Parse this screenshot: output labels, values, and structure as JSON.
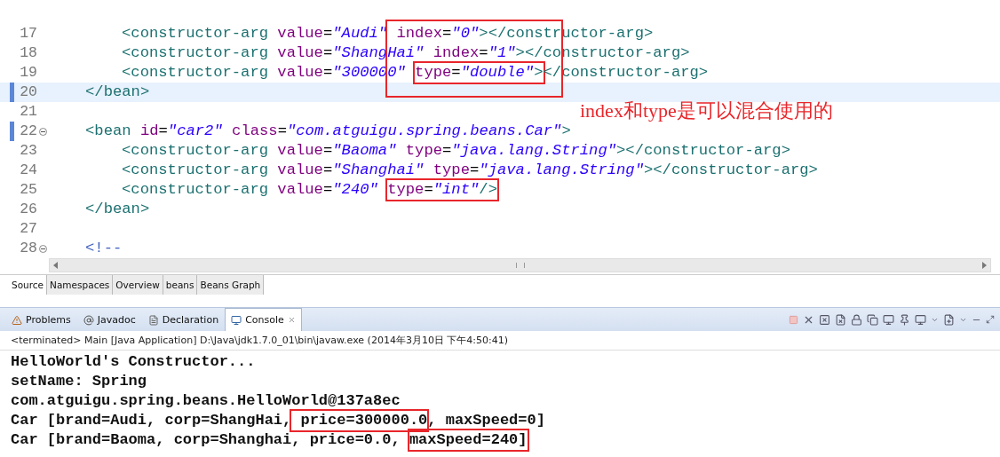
{
  "editor": {
    "lines": [
      {
        "children": [
          {
            "number": "17",
            "fold": false,
            "changed": false,
            "current": false,
            "tokens": [
              {
                "kind": "tag",
                "text": "<constructor-arg"
              },
              {
                "kind": "attr",
                "text": " value"
              },
              {
                "kind": "eq",
                "text": "="
              },
              {
                "kind": "value",
                "text": "\"Audi\""
              },
              {
                "kind": "attr",
                "text": " index"
              },
              {
                "kind": "eq",
                "text": "="
              },
              {
                "kind": "value",
                "text": "\"0\""
              },
              {
                "kind": "tag",
                "text": "></constructor-arg>"
              }
            ]
          },
          {
            "number": "18",
            "fold": false,
            "changed": false,
            "current": false,
            "tokens": [
              {
                "kind": "tag",
                "text": "<constructor-arg"
              },
              {
                "kind": "attr",
                "text": " value"
              },
              {
                "kind": "eq",
                "text": "="
              },
              {
                "kind": "value",
                "text": "\"ShangHai\""
              },
              {
                "kind": "attr",
                "text": " index"
              },
              {
                "kind": "eq",
                "text": "="
              },
              {
                "kind": "value",
                "text": "\"1\""
              },
              {
                "kind": "tag",
                "text": "></constructor-arg>"
              }
            ]
          },
          {
            "number": "19",
            "fold": false,
            "changed": false,
            "current": false,
            "tokens": [
              {
                "kind": "tag",
                "text": "<constructor-arg"
              },
              {
                "kind": "attr",
                "text": " value"
              },
              {
                "kind": "eq",
                "text": "="
              },
              {
                "kind": "value",
                "text": "\"300000\" "
              },
              {
                "kind": "group",
                "boxed": true,
                "tokens": [
                  {
                    "kind": "attr",
                    "text": "type"
                  },
                  {
                    "kind": "eq",
                    "text": "="
                  },
                  {
                    "kind": "value",
                    "text": "\"double\""
                  },
                  {
                    "kind": "tag",
                    "text": ">"
                  }
                ]
              },
              {
                "kind": "tag",
                "text": "</constructor-arg>"
              }
            ]
          }
        ]
      },
      {
        "number": "20",
        "fold": false,
        "changed": true,
        "current": true,
        "tokens": [
          {
            "kind": "tag",
            "text": "</bean>"
          }
        ]
      },
      {
        "number": "21",
        "fold": false,
        "changed": false,
        "current": false
      },
      {
        "number": "22",
        "fold": true,
        "changed": true,
        "current": false,
        "tokens": [
          {
            "kind": "tag",
            "text": "<bean"
          },
          {
            "kind": "attr",
            "text": " id"
          },
          {
            "kind": "eq",
            "text": "="
          },
          {
            "kind": "value",
            "text": "\"car2\""
          },
          {
            "kind": "attr",
            "text": " class"
          },
          {
            "kind": "eq",
            "text": "="
          },
          {
            "kind": "value",
            "text": "\"com.atguigu.spring.beans.Car\""
          },
          {
            "kind": "tag",
            "text": ">"
          }
        ],
        "children": [
          {
            "number": "23",
            "fold": false,
            "changed": false,
            "current": false,
            "tokens": [
              {
                "kind": "tag",
                "text": "<constructor-arg"
              },
              {
                "kind": "attr",
                "text": " value"
              },
              {
                "kind": "eq",
                "text": "="
              },
              {
                "kind": "value",
                "text": "\"Baoma\""
              },
              {
                "kind": "attr",
                "text": " type"
              },
              {
                "kind": "eq",
                "text": "="
              },
              {
                "kind": "value",
                "text": "\"java.lang.String\""
              },
              {
                "kind": "tag",
                "text": "></constructor-arg>"
              }
            ]
          },
          {
            "number": "24",
            "fold": false,
            "changed": false,
            "current": false,
            "tokens": [
              {
                "kind": "tag",
                "text": "<constructor-arg"
              },
              {
                "kind": "attr",
                "text": " value"
              },
              {
                "kind": "eq",
                "text": "="
              },
              {
                "kind": "value",
                "text": "\"Shanghai\""
              },
              {
                "kind": "attr",
                "text": " type"
              },
              {
                "kind": "eq",
                "text": "="
              },
              {
                "kind": "value",
                "text": "\"java.lang.String\""
              },
              {
                "kind": "tag",
                "text": "></constructor-arg>"
              }
            ]
          },
          {
            "number": "25",
            "fold": false,
            "changed": false,
            "current": false,
            "tokens": [
              {
                "kind": "tag",
                "text": "<constructor-arg"
              },
              {
                "kind": "attr",
                "text": " value"
              },
              {
                "kind": "eq",
                "text": "="
              },
              {
                "kind": "value",
                "text": "\"240\" "
              },
              {
                "kind": "group",
                "boxed": true,
                "tokens": [
                  {
                    "kind": "attr",
                    "text": "type"
                  },
                  {
                    "kind": "eq",
                    "text": "="
                  },
                  {
                    "kind": "value",
                    "text": "\"int\""
                  },
                  {
                    "kind": "tag",
                    "text": "/>"
                  }
                ]
              }
            ]
          }
        ]
      },
      {
        "number": "26",
        "fold": false,
        "changed": false,
        "current": false,
        "tokens": [
          {
            "kind": "tag",
            "text": "</bean>"
          }
        ]
      },
      {
        "number": "27",
        "fold": false,
        "changed": false,
        "current": false
      },
      {
        "number": "28",
        "fold": true,
        "changed": false,
        "current": false,
        "tokens": [
          {
            "kind": "comment",
            "text": "<!--"
          }
        ]
      }
    ],
    "note": "index和type是可以混合使用的"
  },
  "editor_bottom_tabs": [
    {
      "label": "Source",
      "selected": true
    },
    {
      "label": "Namespaces",
      "selected": false
    },
    {
      "label": "Overview",
      "selected": false
    },
    {
      "label": "beans",
      "selected": false
    },
    {
      "label": "Beans Graph",
      "selected": false
    }
  ],
  "view_tabs": [
    {
      "label": "Problems",
      "kind": "problems",
      "selected": false
    },
    {
      "label": "Javadoc",
      "kind": "javadoc",
      "selected": false
    },
    {
      "label": "Declaration",
      "kind": "declaration",
      "selected": false
    },
    {
      "label": "Console",
      "kind": "console",
      "selected": true
    }
  ],
  "console": {
    "status": "<terminated> Main [Java Application] D:\\Java\\jdk1.7.0_01\\bin\\javaw.exe (2014年3月10日 下午4:50:41)",
    "lines": [
      [
        {
          "text": "HelloWorld's Constructor..."
        }
      ],
      [
        {
          "text": "setName: Spring"
        }
      ],
      [
        {
          "text": "com.atguigu.spring.beans.HelloWorld@137a8ec"
        }
      ],
      [
        {
          "text": "Car [brand=Audi, corp=ShangHai,"
        },
        {
          "text": " price=300000.0",
          "boxed": true
        },
        {
          "text": ", maxSpeed=0]"
        }
      ],
      [
        {
          "text": "Car [brand=Baoma, corp=Shanghai, price=0.0, "
        },
        {
          "text": "maxSpeed=240]",
          "boxed": true
        }
      ]
    ]
  }
}
